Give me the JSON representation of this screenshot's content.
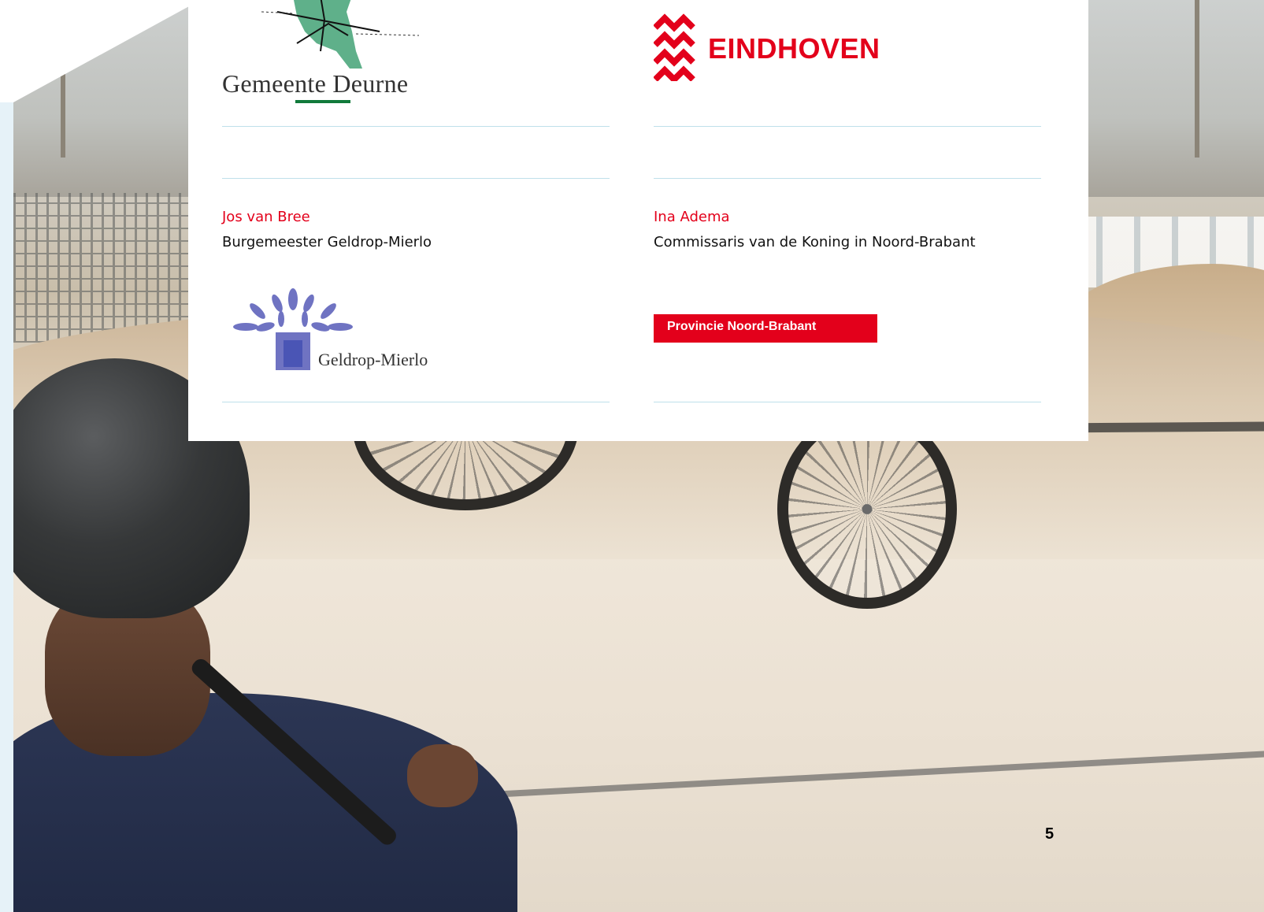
{
  "colors": {
    "accent_red": "#e3001b",
    "rule_blue": "#bfe0ea",
    "deurne_green": "#117a3b",
    "gm_purple": "#6f73c2"
  },
  "left_column": {
    "deurne_logo_text": "Gemeente Deurne",
    "person_name": "Jos van Bree",
    "person_role": "Burgemeester Geldrop-Mierlo",
    "geldrop_logo_text": "Geldrop-Mierlo"
  },
  "right_column": {
    "eindhoven_logo_text": "EINDHOVEN",
    "person_name": "Ina Adema",
    "person_role": "Commissaris van de Koning in Noord-Brabant",
    "provincie_logo_text": "Provincie Noord-Brabant"
  },
  "page_number": "5"
}
